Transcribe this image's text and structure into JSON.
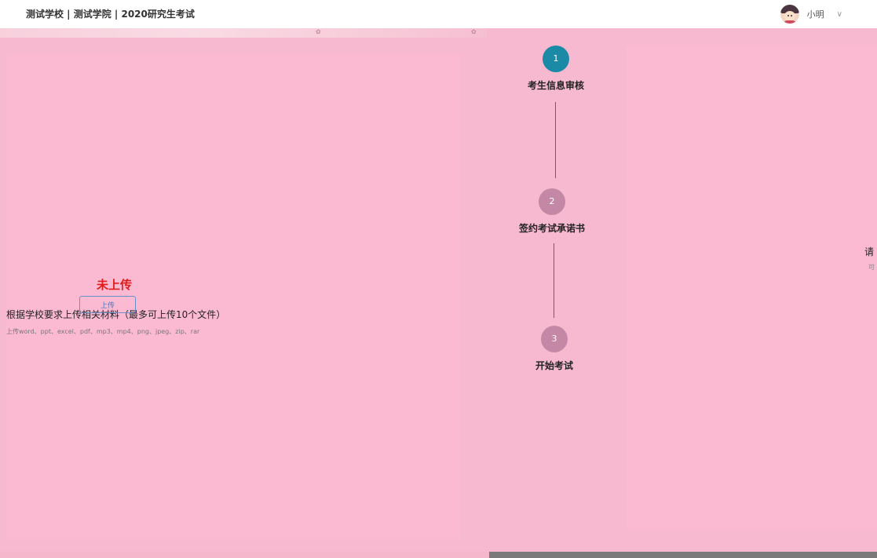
{
  "header": {
    "title": "测试学校 | 测试学院 | 2020研究生考试",
    "username": "小明",
    "chevron": "∨"
  },
  "upload_panel": {
    "status": "未上传",
    "requirement": "根据学校要求上传相关材料（最多可上传10个文件）",
    "formats": "上传word、ppt、excel、pdf、mp3、mp4、png、jpeg、zip、rar",
    "upload_label": "上传"
  },
  "steps": [
    {
      "number": "1",
      "label": "考生信息审核"
    },
    {
      "number": "2",
      "label": "签约考试承诺书"
    },
    {
      "number": "3",
      "label": "开始考试"
    }
  ],
  "right_panel": {
    "title": "请",
    "subtitle": "可"
  },
  "colors": {
    "background": "#f6b9d0",
    "panel": "#fbbad2",
    "active_step": "#1b8aa6",
    "inactive_step": "#c488a6",
    "status_red": "#e21a1a"
  }
}
